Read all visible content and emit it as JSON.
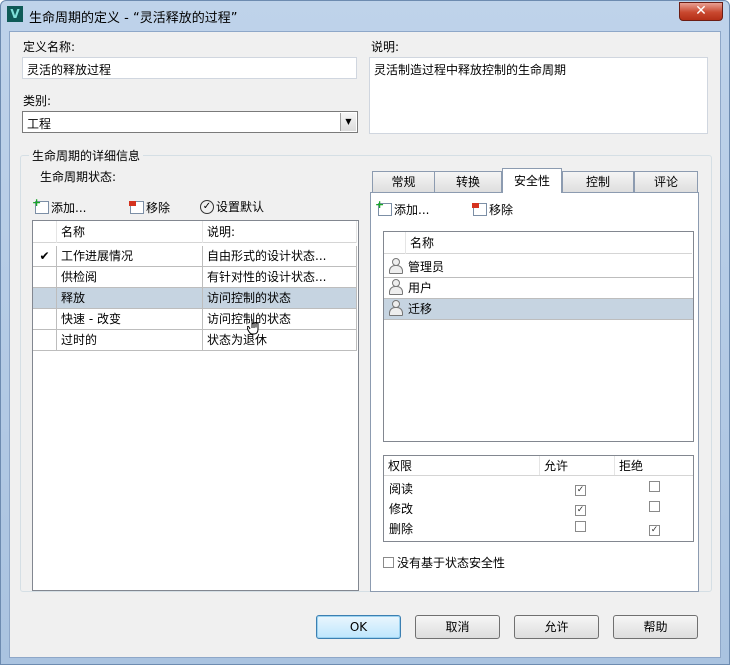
{
  "window": {
    "title": "生命周期的定义 - “灵活释放的过程”",
    "app_icon_letter": "V",
    "close_glyph": "✕"
  },
  "def_name": {
    "label": "定义名称:",
    "value": "灵活的释放过程"
  },
  "description": {
    "label": "说明:",
    "value": "灵活制造过程中释放控制的生命周期"
  },
  "category": {
    "label": "类别:",
    "value": "工程"
  },
  "details_group": {
    "title": "生命周期的详细信息",
    "states_label": "生命周期状态:"
  },
  "left_toolbar": {
    "add": "添加...",
    "remove": "移除",
    "set_default": "设置默认"
  },
  "states_table": {
    "headers": [
      "名称",
      "说明:"
    ],
    "rows": [
      {
        "default": "✔",
        "name": "工作进展情况",
        "desc": "自由形式的设计状态..."
      },
      {
        "default": "",
        "name": "供检阅",
        "desc": "有针对性的设计状态..."
      },
      {
        "default": "",
        "name": "释放",
        "desc": "访问控制的状态"
      },
      {
        "default": "",
        "name": "快速 - 改变",
        "desc": "访问控制的状态"
      },
      {
        "default": "",
        "name": "过时的",
        "desc": "状态为退休"
      }
    ],
    "selected_index": 2
  },
  "tabs": [
    "常规",
    "转换",
    "安全性",
    "控制",
    "评论"
  ],
  "active_tab": "安全性",
  "right_toolbar": {
    "add": "添加...",
    "remove": "移除"
  },
  "users_table": {
    "header": "名称",
    "rows": [
      "管理员",
      "用户",
      "迁移"
    ],
    "selected_index": 2
  },
  "permissions": {
    "headers": [
      "权限",
      "允许",
      "拒绝"
    ],
    "rows": [
      {
        "name": "阅读",
        "allow": true,
        "deny": false
      },
      {
        "name": "修改",
        "allow": true,
        "deny": false
      },
      {
        "name": "删除",
        "allow": false,
        "deny": true
      }
    ]
  },
  "no_state_security": {
    "label": "没有基于状态安全性",
    "checked": false
  },
  "buttons": {
    "ok": "OK",
    "cancel": "取消",
    "allow": "允许",
    "help": "帮助"
  }
}
